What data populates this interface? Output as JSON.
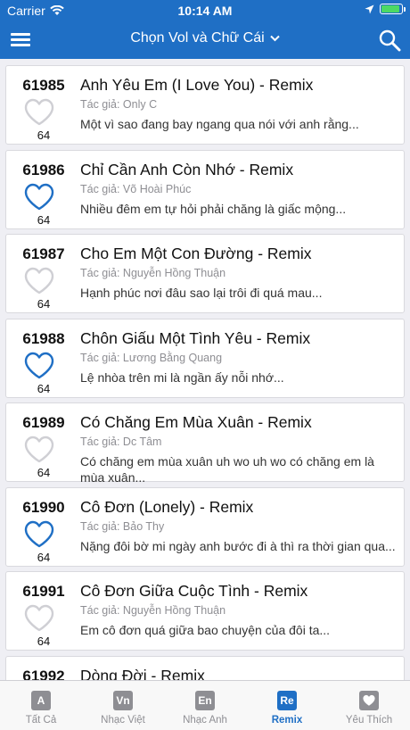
{
  "status": {
    "carrier": "Carrier",
    "time": "10:14 AM",
    "battery_level": 0.9
  },
  "header": {
    "title": "Chọn Vol và Chữ Cái",
    "menu_icon": "hamburger-menu-icon",
    "search_icon": "search-icon",
    "title_dropdown_icon": "chevron-down-icon"
  },
  "colors": {
    "accent": "#1f6fc5",
    "heart_favorited": "#1f6fc5",
    "heart_empty": "#cfcfd4",
    "tab_inactive": "#8e8e93"
  },
  "songs": [
    {
      "code": "61985",
      "favorite": false,
      "count": "64",
      "title": "Anh Yêu Em (I Love You) - Remix",
      "author": "Tác giả: Only C",
      "lyric": "Một vì sao đang bay ngang qua nói với anh rằng..."
    },
    {
      "code": "61986",
      "favorite": true,
      "count": "64",
      "title": "Chỉ Cần Anh Còn Nhớ - Remix",
      "author": "Tác giả: Võ Hoài Phúc",
      "lyric": "Nhiều đêm em tự hỏi phải chăng là giấc mộng..."
    },
    {
      "code": "61987",
      "favorite": false,
      "count": "64",
      "title": "Cho Em Một Con Đường - Remix",
      "author": "Tác giả: Nguyễn Hồng Thuận",
      "lyric": "Hạnh phúc nơi đâu sao lại trôi đi quá mau..."
    },
    {
      "code": "61988",
      "favorite": true,
      "count": "64",
      "title": "Chôn Giấu Một Tình Yêu - Remix",
      "author": "Tác giả: Lương Bằng Quang",
      "lyric": "Lệ nhòa trên mi là ngần ấy nỗi nhớ..."
    },
    {
      "code": "61989",
      "favorite": false,
      "count": "64",
      "title": "Có Chăng Em Mùa Xuân - Remix",
      "author": "Tác giả: Dc Tâm",
      "lyric": "Có chăng em mùa xuân uh wo uh wo có chăng em là mùa xuân..."
    },
    {
      "code": "61990",
      "favorite": true,
      "count": "64",
      "title": "Cô Đơn (Lonely) - Remix",
      "author": "Tác giả: Bảo Thy",
      "lyric": "Nặng đôi bờ mi ngày anh bước đi à thì ra thời gian qua..."
    },
    {
      "code": "61991",
      "favorite": false,
      "count": "64",
      "title": "Cô Đơn Giữa Cuộc Tình - Remix",
      "author": "Tác giả: Nguyễn Hồng Thuận",
      "lyric": "Em cô đơn quá giữa bao chuyện của đôi ta..."
    },
    {
      "code": "61992",
      "favorite": false,
      "count": "",
      "title": "Dòng Đời - Remix",
      "author": "",
      "lyric": ""
    }
  ],
  "tabs": [
    {
      "label": "Tất Cả",
      "glyph": "A",
      "icon": "letter-a-icon",
      "active": false
    },
    {
      "label": "Nhạc Việt",
      "glyph": "Vn",
      "icon": "vietnamese-music-icon",
      "active": false
    },
    {
      "label": "Nhạc Anh",
      "glyph": "En",
      "icon": "english-music-icon",
      "active": false
    },
    {
      "label": "Remix",
      "glyph": "Re",
      "icon": "remix-icon",
      "active": true
    },
    {
      "label": "Yêu Thích",
      "glyph": "",
      "icon": "heart-icon",
      "active": false
    }
  ]
}
